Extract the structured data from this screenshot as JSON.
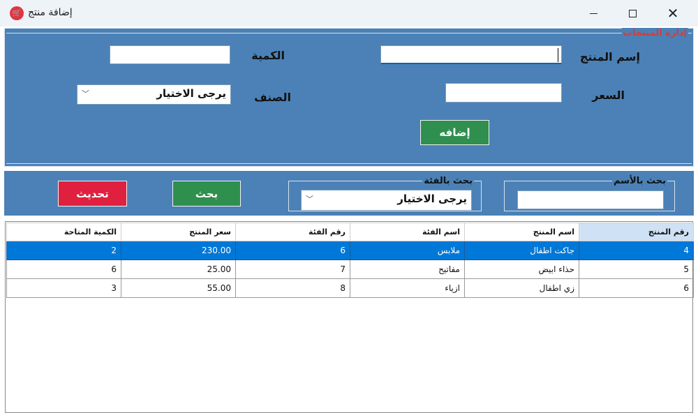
{
  "window": {
    "title": "إضافة منتج",
    "icon": "shopping-cart-icon",
    "close_glyph": "✕"
  },
  "product_section": {
    "title": "إدارة المنتجات",
    "name_label": "إسم المنتج",
    "name_value": "",
    "quantity_label": "الكمية",
    "quantity_value": "",
    "price_label": "السعر",
    "price_value": "",
    "category_label": "الصنف",
    "category_selected": "يرجى الاختيار",
    "add_button": "إضافه"
  },
  "search_section": {
    "search_by_name_title": "بحث بالأسم",
    "search_name_value": "",
    "search_by_category_title": "بحث بالفئة",
    "category_selected": "يرجى الاختيار",
    "search_button": "بحث",
    "refresh_button": "تحديث"
  },
  "table": {
    "columns": [
      "رقم المنتج",
      "اسم المنتج",
      "اسم الفئة",
      "رقم الفئة",
      "سعر المنتج",
      "الكمية المتاحة"
    ],
    "rows": [
      [
        "4",
        "جاكت اطفال",
        "ملابس",
        "6",
        "230.00",
        "2"
      ],
      [
        "5",
        "حذاء ابيض",
        "مفاتيح",
        "7",
        "25.00",
        "6"
      ],
      [
        "6",
        "زي اطفال",
        "ازياء",
        "8",
        "55.00",
        "3"
      ]
    ],
    "selected_row": 0
  },
  "colors": {
    "panel": "#4b81b6",
    "accent_red": "#d83a3a",
    "button_green": "#2f8f4e",
    "button_red": "#e0203f",
    "selection": "#0078d7"
  }
}
